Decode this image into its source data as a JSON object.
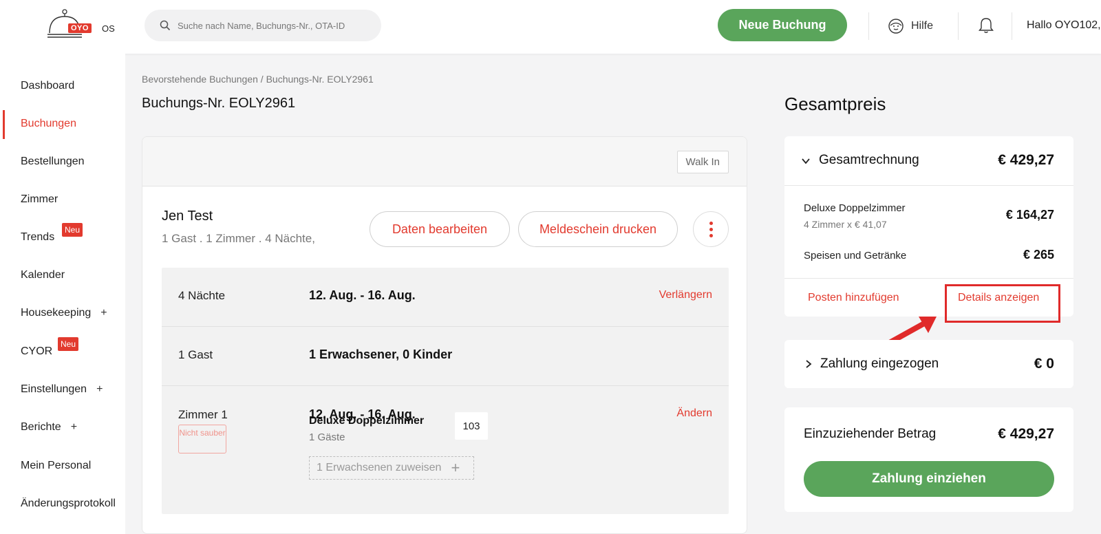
{
  "header": {
    "logo_brand": "OYO",
    "logo_suffix": "OS",
    "search_placeholder": "Suche nach Name, Buchungs-Nr., OTA-ID",
    "new_booking_label": "Neue Buchung",
    "help_label": "Hilfe",
    "greeting": "Hallo OYO102,"
  },
  "sidebar": {
    "items": [
      {
        "label": "Dashboard"
      },
      {
        "label": "Buchungen"
      },
      {
        "label": "Bestellungen"
      },
      {
        "label": "Zimmer"
      },
      {
        "label": "Trends",
        "badge": "Neu"
      },
      {
        "label": "Kalender"
      },
      {
        "label": "Housekeeping",
        "plus": "+"
      },
      {
        "label": "CYOR",
        "badge": "Neu"
      },
      {
        "label": "Einstellungen",
        "plus": "+"
      },
      {
        "label": "Berichte",
        "plus": "+"
      },
      {
        "label": "Mein Personal"
      },
      {
        "label": "Änderungsprotokoll"
      }
    ]
  },
  "main": {
    "breadcrumb": "Bevorstehende Buchungen / Buchungs-Nr. EOLY2961",
    "title": "Buchungs-Nr. EOLY2961",
    "walk_in": "Walk In",
    "guest_name": "Jen Test",
    "guest_summary": "1 Gast . 1 Zimmer . 4 Nächte,",
    "edit_button": "Daten bearbeiten",
    "print_button": "Meldeschein drucken",
    "nights_label": "4 Nächte",
    "nights_value": "12. Aug. - 16. Aug.",
    "extend_link": "Verlängern",
    "guests_label": "1 Gast",
    "guests_value": "1 Erwachsener, 0 Kinder",
    "room_label": "Zimmer 1",
    "room_status": "Nicht sauber",
    "room_dates": "12. Aug. - 16. Aug.",
    "change_link": "Ändern",
    "room_type": "Deluxe Doppelzimmer",
    "room_guests": "1 Gäste",
    "room_number": "103",
    "assign_label": "1 Erwachsenen zuweisen"
  },
  "pricing": {
    "title": "Gesamtpreis",
    "total_invoice_label": "Gesamtrechnung",
    "total_invoice_amount": "€ 429,27",
    "line1_label": "Deluxe Doppelzimmer",
    "line1_sub": "4 Zimmer x € 41,07",
    "line1_amount": "€ 164,27",
    "line2_label": "Speisen und Getränke",
    "line2_amount": "€ 265",
    "add_item_link": "Posten hinzufügen",
    "show_details_link": "Details anzeigen",
    "payment_collected_label": "Zahlung eingezogen",
    "payment_collected_amount": "€ 0",
    "due_label": "Einzuziehender Betrag",
    "due_amount": "€ 429,27",
    "collect_button": "Zahlung einziehen"
  },
  "colors": {
    "accent_red": "#e23a2e",
    "green": "#5aa55b",
    "highlight": "#e02a2a"
  }
}
